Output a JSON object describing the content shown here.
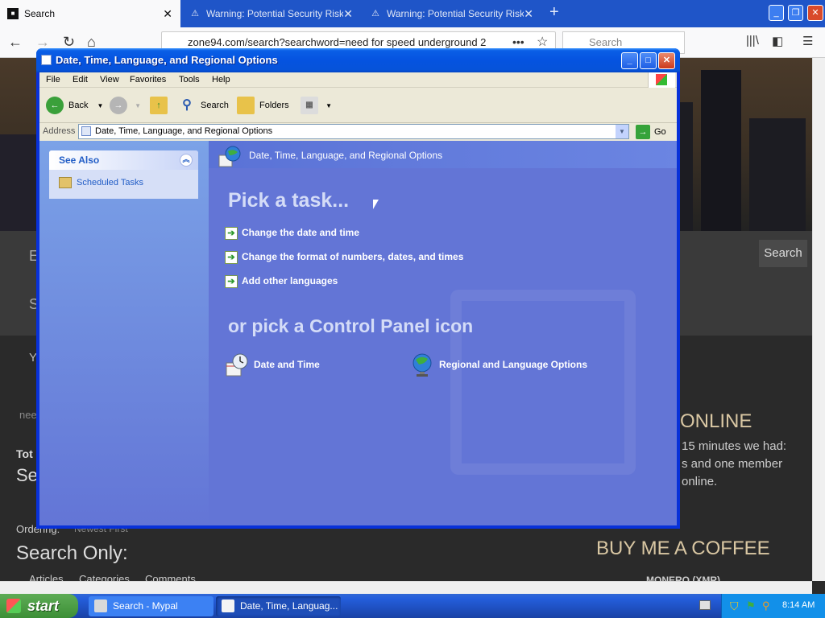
{
  "firefox": {
    "tabs": [
      {
        "title": "Search",
        "active": true
      },
      {
        "title": "Warning: Potential Security Risk Ah",
        "active": false
      },
      {
        "title": "Warning: Potential Security Risk Ah",
        "active": false
      }
    ],
    "new_tab_label": "+",
    "url": "zone94.com/search?searchword=need for speed underground 2",
    "search_placeholder": "Search",
    "page": {
      "search_button": "Search",
      "who_online": "ONLINE",
      "online_text_1": "15 minutes we had:",
      "online_text_2": "s and one member",
      "online_text_3": "online.",
      "buy_coffee": "BUY ME A COFFEE",
      "search_only": "Search Only:",
      "ordering_label": "Ordering:",
      "ordering_value": "Newest First",
      "tot": "Tot",
      "se": "Se",
      "checkbox_articles": "Articles",
      "checkbox_categories": "Categories",
      "checkbox_comments": "Comments",
      "input_value": "nee",
      "partial_e": "E",
      "partial_s": "S",
      "partial_y": "Y",
      "monero": "MONERO (XMR)"
    }
  },
  "explorer": {
    "title": "Date, Time, Language, and Regional Options",
    "menu": [
      "File",
      "Edit",
      "View",
      "Favorites",
      "Tools",
      "Help"
    ],
    "toolbar": {
      "back": "Back",
      "search": "Search",
      "folders": "Folders"
    },
    "address_label": "Address",
    "address_value": "Date, Time, Language, and Regional Options",
    "go_label": "Go",
    "see_also": {
      "heading": "See Also",
      "items": [
        "Scheduled Tasks"
      ]
    },
    "content": {
      "heading": "Date, Time, Language, and Regional Options",
      "pick_task": "Pick a task...",
      "tasks": [
        "Change the date and time",
        "Change the format of numbers, dates, and times",
        "Add other languages"
      ],
      "pick_icon": "or pick a Control Panel icon",
      "icons": [
        "Date and Time",
        "Regional and Language Options"
      ]
    }
  },
  "taskbar": {
    "start_label": "start",
    "buttons": [
      "Search - Mypal",
      "Date, Time, Languag..."
    ],
    "clock": "8:14 AM"
  }
}
